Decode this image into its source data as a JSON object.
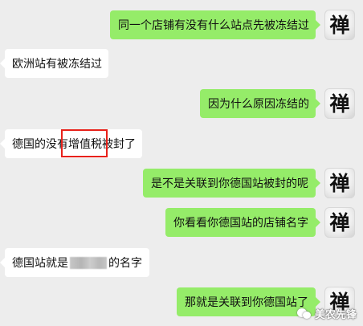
{
  "messages": [
    {
      "side": "right",
      "text": "同一个店铺有没有什么站点先被冻结过"
    },
    {
      "side": "left",
      "text": "欧洲站有被冻结过"
    },
    {
      "side": "right",
      "text": "因为什么原因冻结的"
    },
    {
      "side": "left",
      "text": "德国的没有增值税被封了"
    },
    {
      "side": "right",
      "text": "是不是关联到你德国站被封的呢"
    },
    {
      "side": "right",
      "text": "你看看你德国站的店铺名字"
    },
    {
      "side": "left",
      "text_before": "德国站就是",
      "text_after": "的名字",
      "redacted": true
    },
    {
      "side": "right",
      "text": "那就是关联到你德国站了"
    }
  ],
  "avatar": {
    "glyph": "禅",
    "icon": "calligraphy-avatar"
  },
  "highlight": {
    "color": "#e8211a",
    "target": "增值税"
  },
  "colors": {
    "background": "#ededed",
    "own_bubble": "#95ec69",
    "other_bubble": "#ffffff"
  },
  "watermark": {
    "text": "美农先锋",
    "icon": "wechat-logo-icon"
  }
}
